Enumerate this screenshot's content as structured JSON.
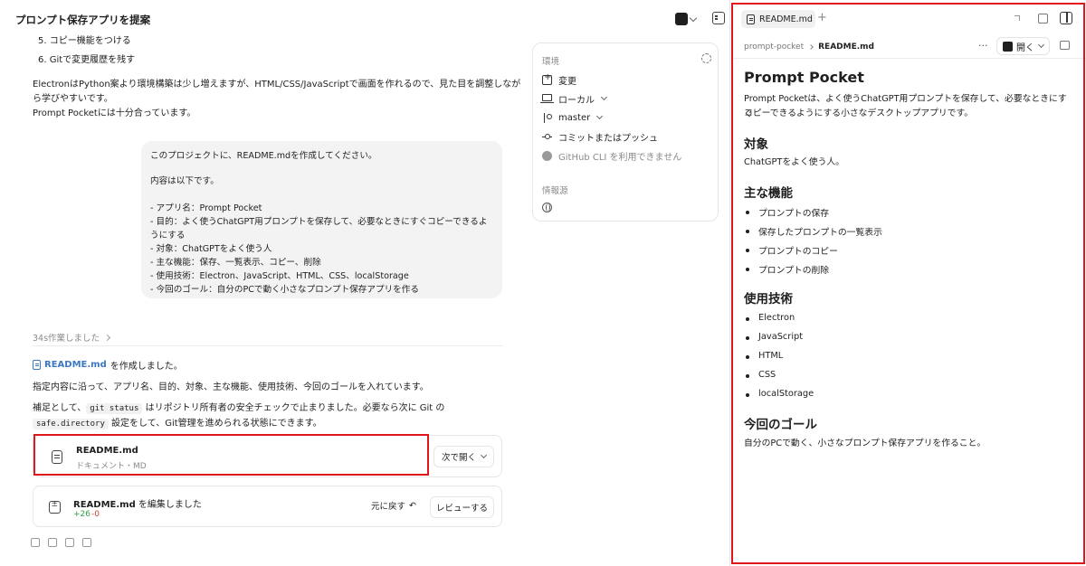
{
  "header": {
    "title": "プロンプト保存アプリを提案",
    "menu_label": "···"
  },
  "steps": [
    {
      "number": "5.",
      "text": "コピー機能をつける"
    },
    {
      "number": "6.",
      "text": "Gitで変更履歴を残す"
    }
  ],
  "assistant_intro": {
    "line1": "ElectronはPython案より環境構築は少し増えますが、HTML/CSS/JavaScriptで画面を作れるので、見た目を調整しなが",
    "line2": "ら学びやすいです。",
    "line3": "Prompt Pocketには十分合っています。"
  },
  "environment": {
    "title": "環境",
    "items": [
      {
        "label": "変更",
        "icon": "diff-icon"
      },
      {
        "label": "ローカル",
        "icon": "laptop-icon"
      },
      {
        "label": "master",
        "icon": "branch-icon"
      },
      {
        "label": "コミットまたはプッシュ",
        "icon": "commit-icon"
      },
      {
        "label": "GitHub CLI を利用できません",
        "icon": "github-icon"
      }
    ],
    "sources_title": "情報源"
  },
  "user_message": {
    "lines": [
      "このプロジェクトに、README.mdを作成してください。",
      "",
      "内容は以下です。",
      "",
      "- アプリ名：Prompt Pocket",
      "- 目的：よく使うChatGPT用プロンプトを保存して、必要なときにすぐコピーできるよ",
      "うにする",
      "- 対象：ChatGPTをよく使う人",
      "- 主な機能：保存、一覧表示、コピー、削除",
      "- 使用技術：Electron、JavaScript、HTML、CSS、localStorage",
      "- 今回のゴール：自分のPCで動く小さなプロンプト保存アプリを作る"
    ]
  },
  "worked": {
    "label": "34s作業しました"
  },
  "response": {
    "created_file": "README.md",
    "created_suffix": " を作成しました。",
    "line2": "指定内容に沿って、アプリ名、目的、対象、主な機能、使用技術、今回のゴールを入れています。",
    "line3_a": "補足として、",
    "code_git_status": "git status",
    "line3_b": " はリポジトリ所有者の安全チェックで止まりました。必要なら次に Git の",
    "code_safe_dir": "safe.directory",
    "line4_b": " 設定をして、Git管理を進められる状態にできます。"
  },
  "file_card": {
    "name": "README.md",
    "type": "ドキュメント・MD",
    "open_label": "次で開く"
  },
  "edit_card": {
    "file": "README.md",
    "action": " を編集しました",
    "additions": "+26",
    "deletions": "-0",
    "revert_label": "元に戻す",
    "review_label": "レビューする"
  },
  "preview": {
    "tab_label": "README.md",
    "breadcrumb_root": "prompt-pocket",
    "breadcrumb_file": "README.md",
    "open_label": "開く",
    "h1": "Prompt Pocket",
    "intro_line1": "Prompt Pocketは、よく使うChatGPT用プロンプトを保存して、必要なときにすぐ",
    "intro_line2": "コピーできるようにする小さなデスクトップアプリです。",
    "audience_heading": "対象",
    "audience_text": "ChatGPTをよく使う人。",
    "features_heading": "主な機能",
    "features": [
      "プロンプトの保存",
      "保存したプロンプトの一覧表示",
      "プロンプトのコピー",
      "プロンプトの削除"
    ],
    "tech_heading": "使用技術",
    "tech": [
      "Electron",
      "JavaScript",
      "HTML",
      "CSS",
      "localStorage"
    ],
    "goal_heading": "今回のゴール",
    "goal_text": "自分のPCで動く、小さなプロンプト保存アプリを作ること。"
  },
  "colors": {
    "highlight": "#e0181b",
    "link": "#3b78c4",
    "additions": "#2f9e44",
    "deletions": "#d23b3b"
  }
}
